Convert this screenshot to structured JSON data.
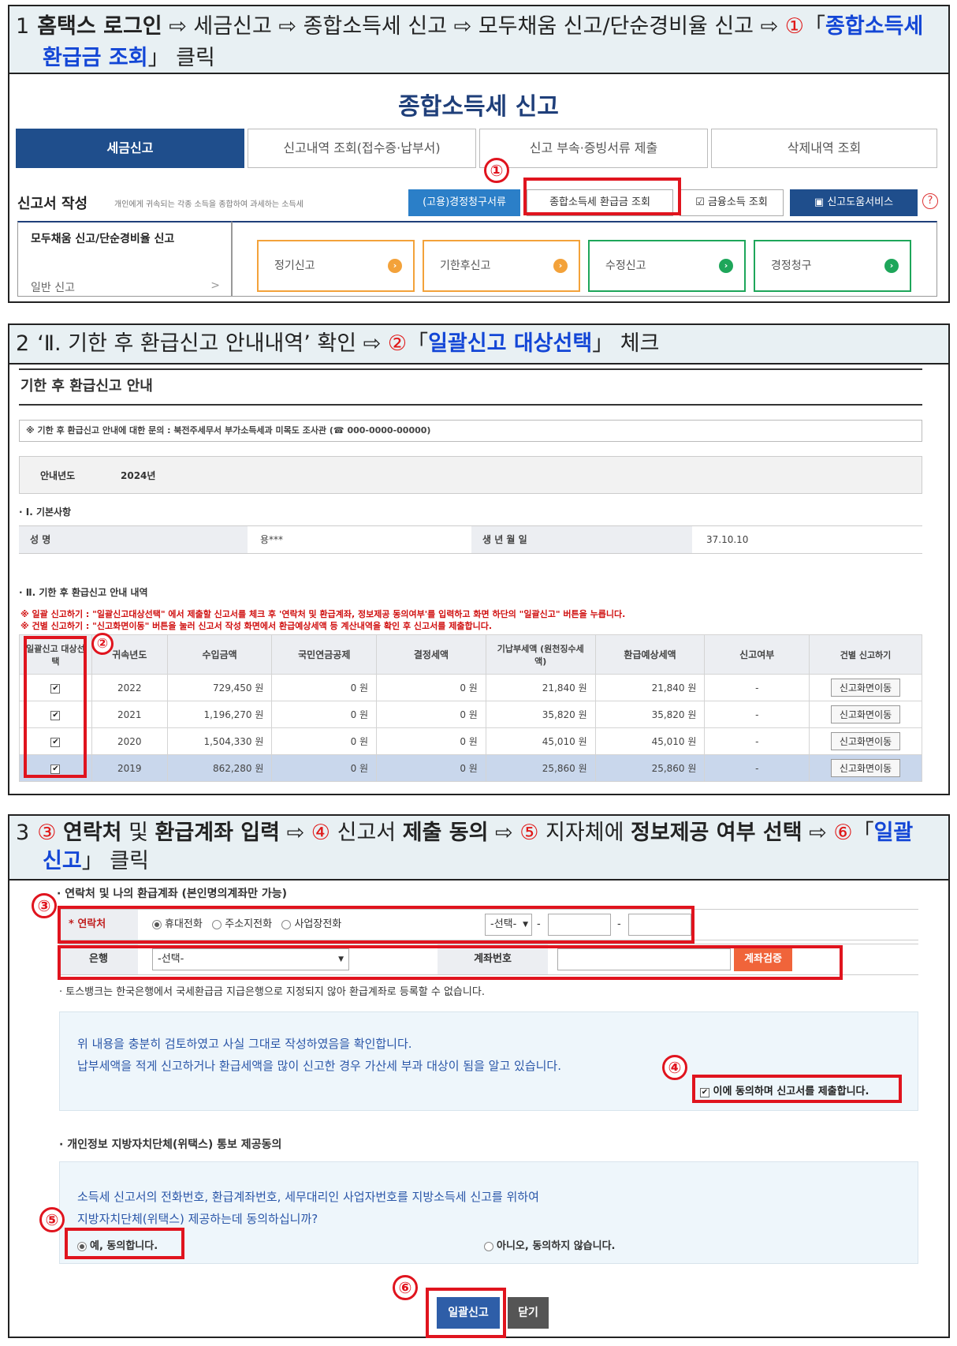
{
  "step1": {
    "number": "1",
    "instruction_plain_1": "홈택스 로그인",
    "instruction_plain_2": " ⇨ 세금신고 ⇨ 종합소득세 신고 ⇨ 모두채움 신고/단순경비율 신고 ⇨ ",
    "circle": "①",
    "quote_open": "「",
    "highlight_1": "종합소득세",
    "highlight_2": "환급금 조회",
    "quote_close": "」",
    "click": " 클릭",
    "page_title": "종합소득세 신고",
    "tabs": [
      "세금신고",
      "신고내역 조회(접수증·납부서)",
      "신고 부속·증빙서류 제출",
      "삭제내역 조회"
    ],
    "form_title": "신고서 작성",
    "form_subtitle": "개인에게 귀속되는 각종 소득을 종합하여 과세하는 소득세",
    "small_buttons": [
      "(고용)경정청구서류",
      "종합소득세 환급금 조회",
      "금융소득 조회",
      "신고도움서비스"
    ],
    "help": "?",
    "left_menu_1": "모두채움 신고/단순경비율 신고",
    "left_menu_2": "일반 신고",
    "left_menu_arrow": ">",
    "cards": [
      "정기신고",
      "기한후신고",
      "수정신고",
      "경정청구"
    ],
    "card_arrow": "›",
    "marker": "①"
  },
  "step2": {
    "number": "2",
    "instruction_1": "‘Ⅱ. 기한 후 환급신고 안내내역’ 확인 ⇨ ",
    "circle": "②",
    "quote_open": "「",
    "highlight": "일괄신고 대상선택",
    "quote_close": "」",
    "after": " 체크",
    "section_title": "기한 후 환급신고 안내",
    "contact_line": "※ 기한 후 환급신고 안내에 대한 문의 : 북전주세무서 부가소득세과 미목도 조사관 (☎ 000-0000-00000)",
    "year_label": "안내년도",
    "year_value": "2024년",
    "basic_title": "· Ⅰ. 기본사항",
    "name_label": "성          명",
    "name_value": "용***",
    "birth_label": "생   년   월   일",
    "birth_value": "37.10.10",
    "details_title": "· Ⅱ. 기한 후 환급신고 안내 내역",
    "notice_1": "※ 일괄 신고하기 : \"일괄신고대상선택\" 에서 제출할 신고서를 체크 후 '연락처 및 환급계좌, 정보제공 동의여부'를 입력하고 화면 하단의 \"일괄신고\" 버튼을 누릅니다.",
    "notice_2": "※ 건별 신고하기 : \"신고화면이동\" 버튼을 눌러 신고서 작성 화면에서 환급예상세액 등 계산내역을 확인 후 신고서를 제출합니다.",
    "columns": [
      "일괄신고 대상선택",
      "귀속년도",
      "수입금액",
      "국민연금공제",
      "결정세액",
      "기납부세액 (원천징수세액)",
      "환급예상세액",
      "신고여부",
      "건별 신고하기"
    ],
    "rows": [
      [
        "✔",
        "2022",
        "729,450 원",
        "0 원",
        "0 원",
        "21,840 원",
        "21,840 원",
        "-",
        "신고화면이동"
      ],
      [
        "✔",
        "2021",
        "1,196,270 원",
        "0 원",
        "0 원",
        "35,820 원",
        "35,820 원",
        "-",
        "신고화면이동"
      ],
      [
        "✔",
        "2020",
        "1,504,330 원",
        "0 원",
        "0 원",
        "45,010 원",
        "45,010 원",
        "-",
        "신고화면이동"
      ],
      [
        "✔",
        "2019",
        "862,280 원",
        "0 원",
        "0 원",
        "25,860 원",
        "25,860 원",
        "-",
        "신고화면이동"
      ]
    ],
    "marker": "②"
  },
  "step3": {
    "number": "3",
    "c3": "③",
    "t1": "연락처",
    "t2": " 및 ",
    "t3": "환급계좌 입력",
    "arrow": " ⇨ ",
    "c4": "④",
    "t4": " 신고서 ",
    "t5": "제출 동의",
    "c5": "⑤",
    "t6": " 지자체에 ",
    "t7": "정보제공 여부 선택",
    "c6": "⑥",
    "quote_open": "「",
    "t8": "일괄",
    "t9": "신고",
    "quote_close": "」",
    "t10": " 클릭",
    "account_title": "· 연락처 및 나의 환급계좌 (본인명의계좌만 가능)",
    "contact_label": "* 연락처",
    "phone_options": [
      "휴대전화",
      "주소지전화",
      "사업장전화"
    ],
    "select_default": "-선택-",
    "dash": "-",
    "bank_label": "은행",
    "bank_default": "-선택-",
    "account_label": "계좌번호",
    "verify_button": "계좌검증",
    "bank_note": "· 토스뱅크는 한국은행에서 국세환급금 지급은행으로 지정되지 않아 환급계좌로 등록할 수 없습니다.",
    "confirm_1": "위 내용을 충분히 검토하였고 사실 그대로 작성하였음을 확인합니다.",
    "confirm_2": "납부세액을 적게 신고하거나 환급세액을 많이 신고한 경우 가산세 부과 대상이 됨을 알고 있습니다.",
    "agree_label": "이에 동의하며 신고서를 제출합니다.",
    "consent_title": "· 개인정보 지방자치단체(위택스) 통보 제공동의",
    "consent_1": "소득세 신고서의 전화번호, 환급계좌번호, 세무대리인 사업자번호를 지방소득세 신고를 위하여",
    "consent_2": "지방자치단체(위택스) 제공하는데 동의하십니까?",
    "yes_label": "예, 동의합니다.",
    "no_label": "아니오, 동의하지 않습니다.",
    "submit_button": "일괄신고",
    "close_button": "닫기"
  },
  "colors": {
    "highlight_blue": "#1346d6",
    "marker_red": "#e0141e",
    "tab_navy": "#1f4e8c",
    "header_bg": "#e8f0f3",
    "card_orange": "#f3a23a",
    "card_green": "#1ea65a"
  }
}
